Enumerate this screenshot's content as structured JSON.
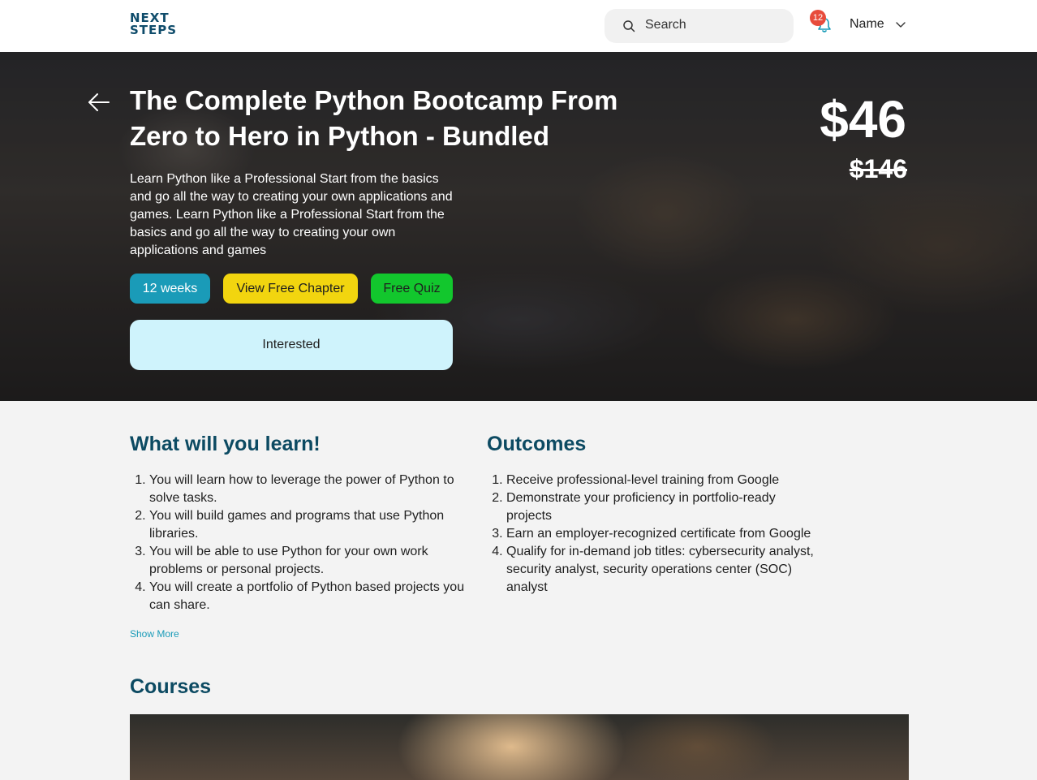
{
  "header": {
    "logo_line1": "NEXT",
    "logo_line2": "STEPS",
    "search_placeholder": "Search",
    "notification_count": "12",
    "user_name": "Name"
  },
  "hero": {
    "title": "The Complete Python Bootcamp From Zero to Hero in Python - Bundled",
    "description": "Learn Python like a Professional Start from the basics and go all the way to creating your own applications and games. Learn Python like a Professional Start from the basics and go all the way to creating your own applications and games",
    "price": "$46",
    "old_price": "$146",
    "duration_label": "12 weeks",
    "free_chapter_label": "View Free Chapter",
    "free_quiz_label": "Free Quiz",
    "interested_label": "Interested"
  },
  "learn": {
    "title": "What will you learn!",
    "items": [
      "You will learn how to leverage the power of Python to solve tasks.",
      "You will build games and programs that use Python libraries.",
      "You will be able to use Python for your own work problems or personal projects.",
      "You will create a portfolio of Python based projects you can share."
    ],
    "show_more_label": "Show More"
  },
  "outcomes": {
    "title": "Outcomes",
    "items": [
      "Receive professional-level training from Google",
      "Demonstrate your proficiency in portfolio-ready projects",
      "Earn an employer-recognized certificate from Google",
      "Qualify for in-demand job titles: cybersecurity analyst, security analyst, security operations center (SOC) analyst"
    ]
  },
  "courses": {
    "title": "Courses"
  },
  "colors": {
    "primary_dark": "#0c4a62",
    "accent_teal": "#1a9bb8",
    "yellow": "#f2d50f",
    "green": "#12c72d",
    "interested_bg": "#cff3fc",
    "badge_red": "#e74c3c"
  }
}
